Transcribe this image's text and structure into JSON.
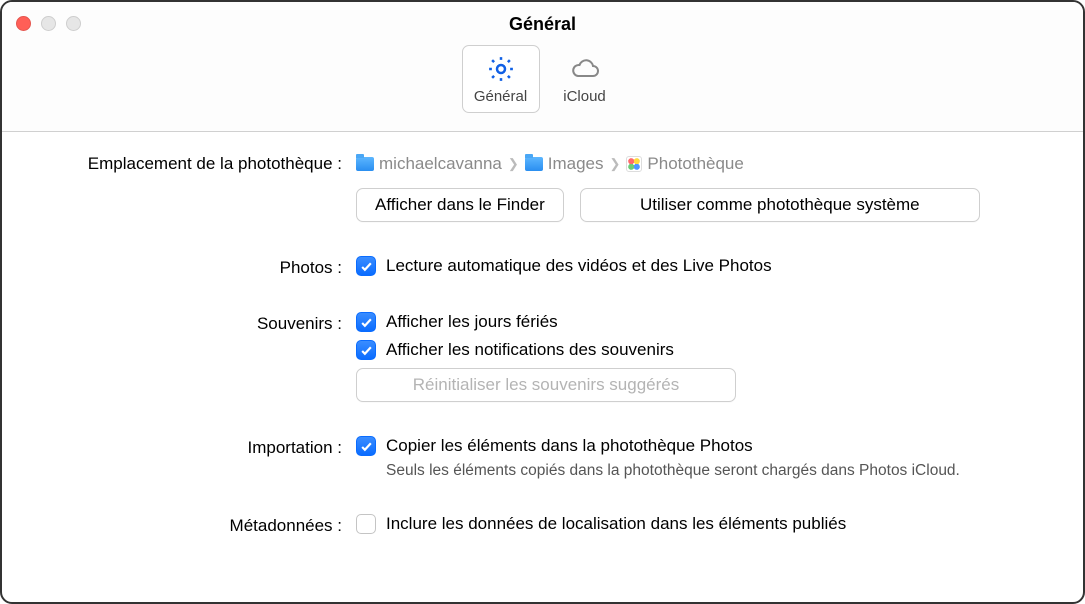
{
  "window": {
    "title": "Général"
  },
  "tabs": {
    "general": "Général",
    "icloud": "iCloud"
  },
  "labels": {
    "library_location": "Emplacement de la photothèque :",
    "photos": "Photos :",
    "memories": "Souvenirs :",
    "import": "Importation :",
    "metadata": "Métadonnées :"
  },
  "breadcrumb": {
    "user": "michaelcavanna",
    "folder": "Images",
    "lib": "Photothèque"
  },
  "buttons": {
    "show_in_finder": "Afficher dans le Finder",
    "use_as_system": "Utiliser comme photothèque système",
    "reset_memories": "Réinitialiser les souvenirs suggérés"
  },
  "options": {
    "autoplay": "Lecture automatique des vidéos et des Live Photos",
    "show_holidays": "Afficher les jours fériés",
    "show_mem_notifs": "Afficher les notifications des souvenirs",
    "copy_items": "Copier les éléments dans la photothèque Photos",
    "copy_items_hint": "Seuls les éléments copiés dans la photothèque seront chargés dans Photos iCloud.",
    "include_location": "Inclure les données de localisation dans les éléments publiés"
  },
  "state": {
    "autoplay_checked": true,
    "show_holidays_checked": true,
    "show_mem_notifs_checked": true,
    "copy_items_checked": true,
    "include_location_checked": false,
    "reset_memories_enabled": false,
    "selected_tab": "general"
  }
}
